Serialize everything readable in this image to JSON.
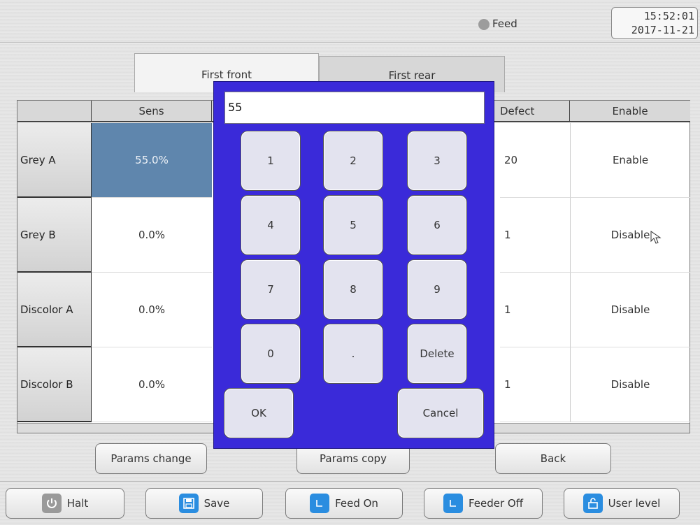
{
  "status": {
    "feed_label": "Feed",
    "time": "15:52:01",
    "date": "2017-11-21"
  },
  "tabs": [
    {
      "label": "First front"
    },
    {
      "label": "First rear"
    }
  ],
  "table": {
    "headers": [
      "",
      "Sens",
      "Defect",
      "Enable"
    ],
    "rows": [
      {
        "name": "Grey A",
        "sens": "55.0%",
        "defect": "20",
        "enable": "Enable"
      },
      {
        "name": "Grey B",
        "sens": "0.0%",
        "defect": "1",
        "enable": "Disable"
      },
      {
        "name": "Discolor A",
        "sens": "0.0%",
        "defect": "1",
        "enable": "Disable"
      },
      {
        "name": "Discolor B",
        "sens": "0.0%",
        "defect": "1",
        "enable": "Disable"
      }
    ]
  },
  "actions": {
    "params_change": "Params change",
    "params_copy": "Params copy",
    "back": "Back"
  },
  "toolbar": {
    "halt": "Halt",
    "save": "Save",
    "feed_on": "Feed On",
    "feeder_off": "Feeder Off",
    "user_level": "User level"
  },
  "keypad": {
    "value": "55",
    "keys": [
      "1",
      "2",
      "3",
      "4",
      "5",
      "6",
      "7",
      "8",
      "9",
      "0",
      ".",
      "Delete"
    ],
    "ok": "OK",
    "cancel": "Cancel"
  },
  "colors": {
    "keypad_bg": "#3a2ad9",
    "selected_cell": "#5f86ad",
    "feed_lamp": "#9c9c9c"
  },
  "icons": {
    "halt": "power-icon",
    "save": "floppy-disk-icon",
    "feed_on": "feed-icon",
    "feeder_off": "feeder-icon",
    "user_level": "lock-icon"
  }
}
